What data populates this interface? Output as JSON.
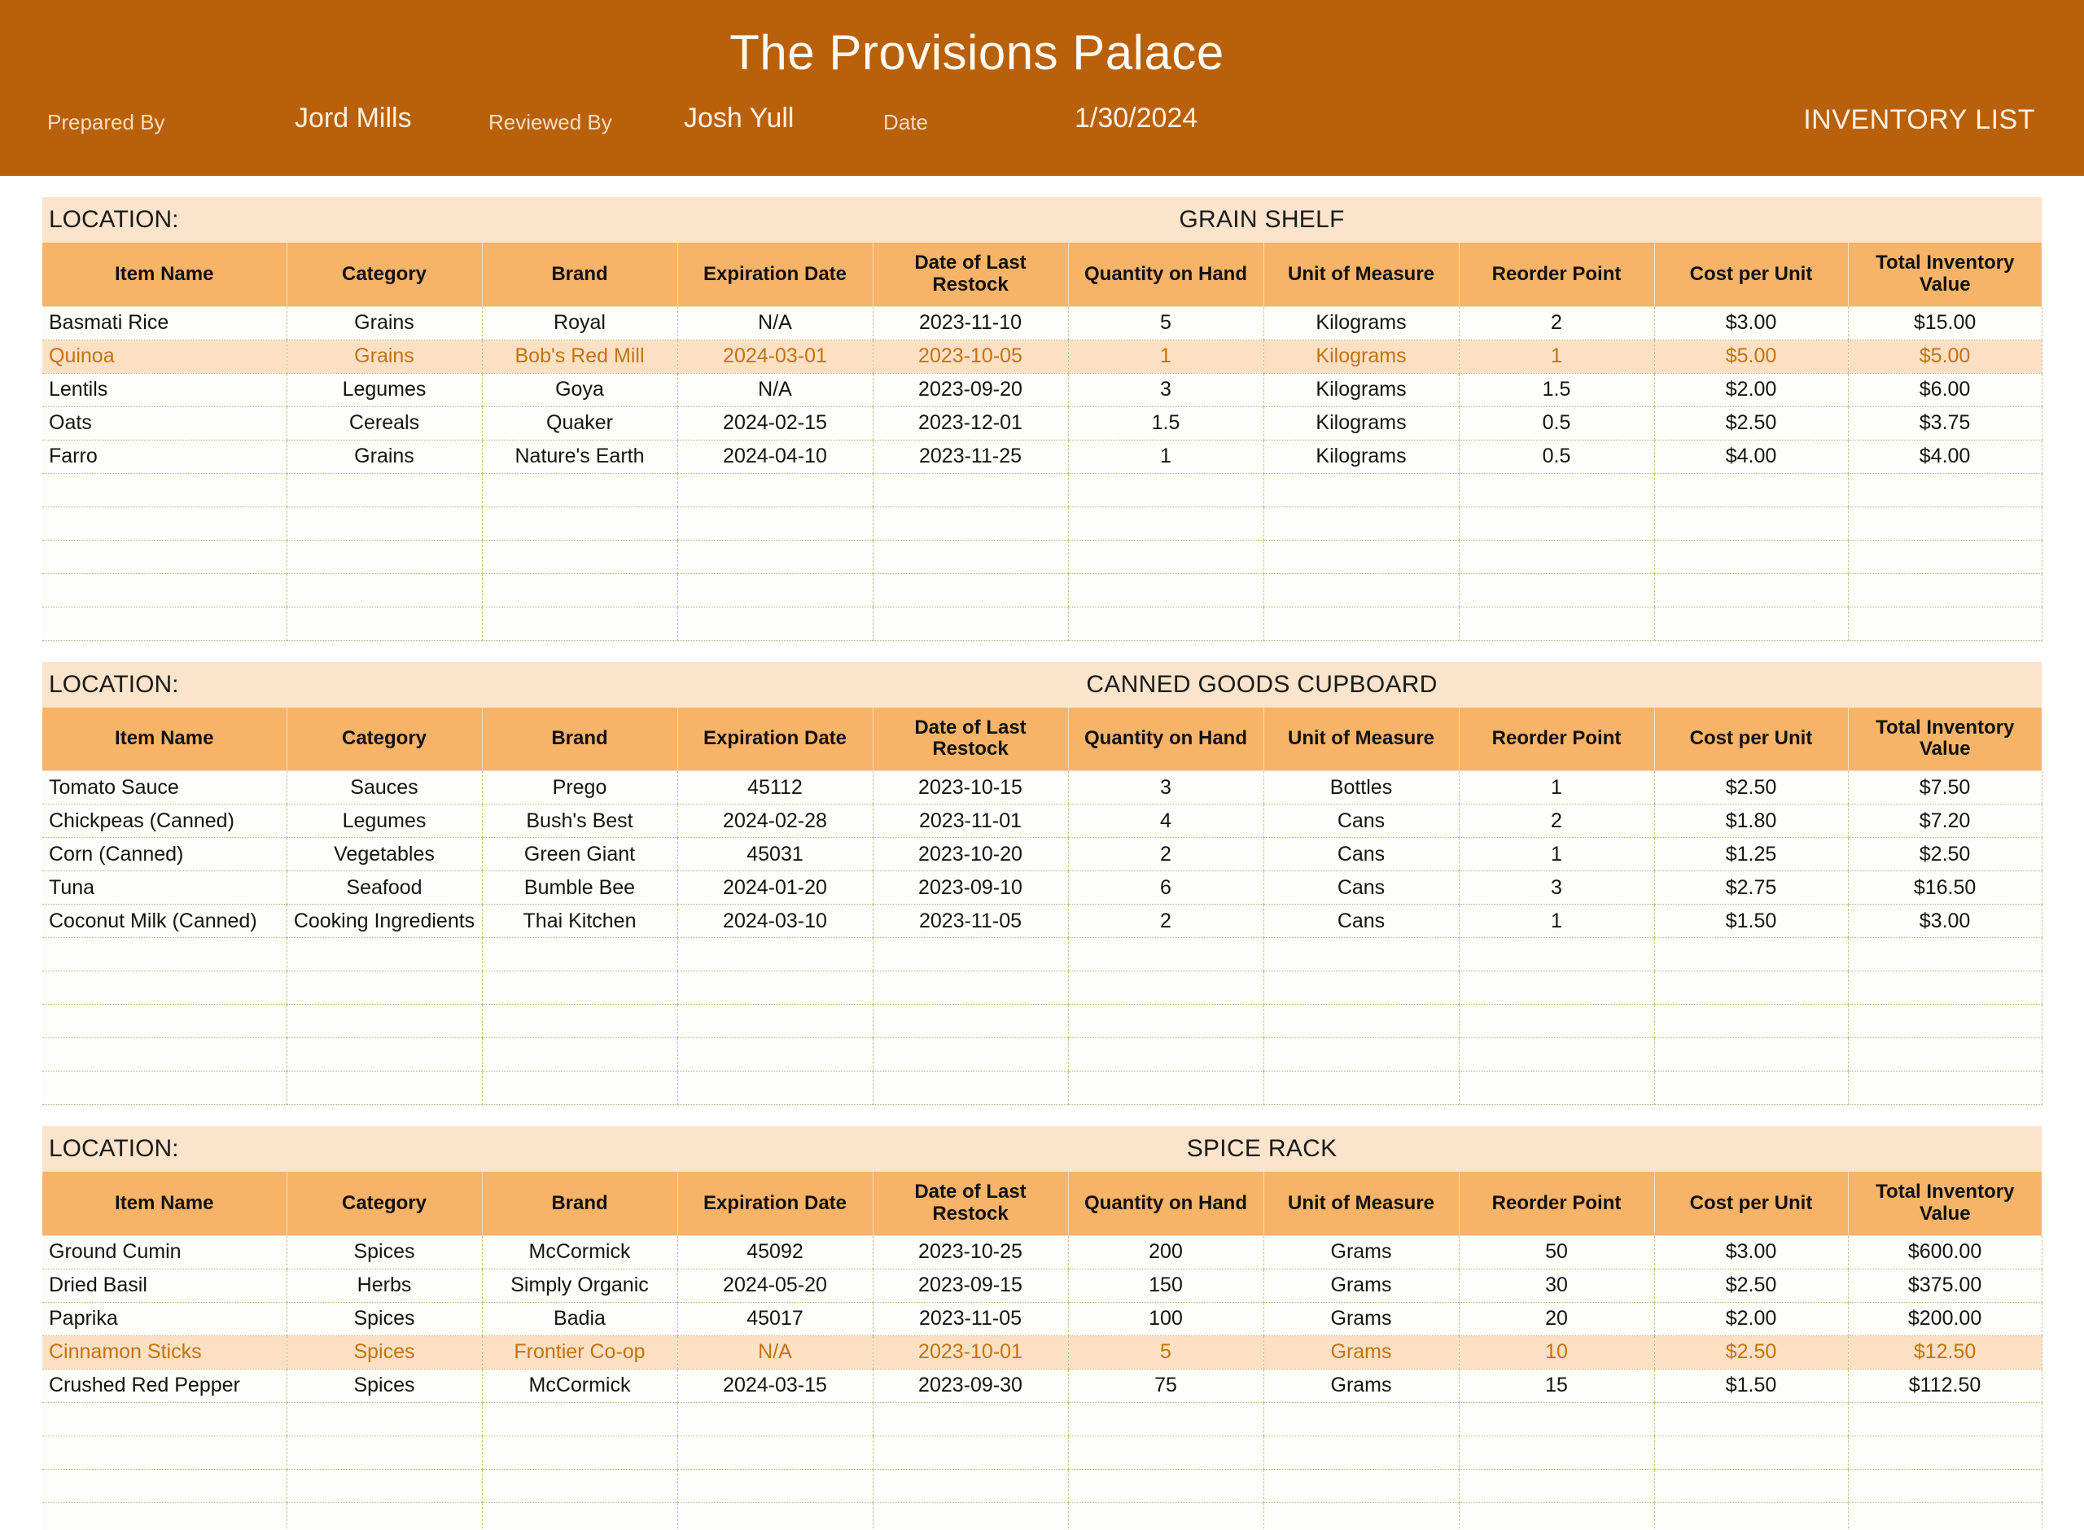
{
  "header": {
    "title": "The Provisions Palace",
    "prepared_by_label": "Prepared By",
    "prepared_by_value": "Jord Mills",
    "reviewed_by_label": "Reviewed By",
    "reviewed_by_value": "Josh Yull",
    "date_label": "Date",
    "date_value": "1/30/2024",
    "document_type": "INVENTORY LIST",
    "banner_color": "#b9600a",
    "accent_color": "#f7b368",
    "highlight_color": "#fbe0c4",
    "highlight_text_color": "#c4720c"
  },
  "location_label": "LOCATION:",
  "columns": [
    "Item Name",
    "Category",
    "Brand",
    "Expiration Date",
    "Date of Last Restock",
    "Quantity on Hand",
    "Unit of Measure",
    "Reorder Point",
    "Cost per Unit",
    "Total Inventory Value"
  ],
  "sections": [
    {
      "location": "GRAIN SHELF",
      "rows": [
        {
          "highlight": false,
          "cells": [
            "Basmati Rice",
            "Grains",
            "Royal",
            "N/A",
            "2023-11-10",
            "5",
            "Kilograms",
            "2",
            "$3.00",
            "$15.00"
          ]
        },
        {
          "highlight": true,
          "cells": [
            "Quinoa",
            "Grains",
            "Bob's Red Mill",
            "2024-03-01",
            "2023-10-05",
            "1",
            "Kilograms",
            "1",
            "$5.00",
            "$5.00"
          ]
        },
        {
          "highlight": false,
          "cells": [
            "Lentils",
            "Legumes",
            "Goya",
            "N/A",
            "2023-09-20",
            "3",
            "Kilograms",
            "1.5",
            "$2.00",
            "$6.00"
          ]
        },
        {
          "highlight": false,
          "cells": [
            "Oats",
            "Cereals",
            "Quaker",
            "2024-02-15",
            "2023-12-01",
            "1.5",
            "Kilograms",
            "0.5",
            "$2.50",
            "$3.75"
          ]
        },
        {
          "highlight": false,
          "cells": [
            "Farro",
            "Grains",
            "Nature's Earth",
            "2024-04-10",
            "2023-11-25",
            "1",
            "Kilograms",
            "0.5",
            "$4.00",
            "$4.00"
          ]
        }
      ],
      "empty_rows": 5
    },
    {
      "location": "CANNED GOODS CUPBOARD",
      "rows": [
        {
          "highlight": false,
          "cells": [
            "Tomato Sauce",
            "Sauces",
            "Prego",
            "45112",
            "2023-10-15",
            "3",
            "Bottles",
            "1",
            "$2.50",
            "$7.50"
          ]
        },
        {
          "highlight": false,
          "cells": [
            "Chickpeas (Canned)",
            "Legumes",
            "Bush's Best",
            "2024-02-28",
            "2023-11-01",
            "4",
            "Cans",
            "2",
            "$1.80",
            "$7.20"
          ]
        },
        {
          "highlight": false,
          "cells": [
            "Corn (Canned)",
            "Vegetables",
            "Green Giant",
            "45031",
            "2023-10-20",
            "2",
            "Cans",
            "1",
            "$1.25",
            "$2.50"
          ]
        },
        {
          "highlight": false,
          "cells": [
            "Tuna",
            "Seafood",
            "Bumble Bee",
            "2024-01-20",
            "2023-09-10",
            "6",
            "Cans",
            "3",
            "$2.75",
            "$16.50"
          ]
        },
        {
          "highlight": false,
          "cells": [
            "Coconut Milk (Canned)",
            "Cooking Ingredients",
            "Thai Kitchen",
            "2024-03-10",
            "2023-11-05",
            "2",
            "Cans",
            "1",
            "$1.50",
            "$3.00"
          ]
        }
      ],
      "empty_rows": 5
    },
    {
      "location": "SPICE RACK",
      "rows": [
        {
          "highlight": false,
          "cells": [
            "Ground Cumin",
            "Spices",
            "McCormick",
            "45092",
            "2023-10-25",
            "200",
            "Grams",
            "50",
            "$3.00",
            "$600.00"
          ]
        },
        {
          "highlight": false,
          "cells": [
            "Dried Basil",
            "Herbs",
            "Simply Organic",
            "2024-05-20",
            "2023-09-15",
            "150",
            "Grams",
            "30",
            "$2.50",
            "$375.00"
          ]
        },
        {
          "highlight": false,
          "cells": [
            "Paprika",
            "Spices",
            "Badia",
            "45017",
            "2023-11-05",
            "100",
            "Grams",
            "20",
            "$2.00",
            "$200.00"
          ]
        },
        {
          "highlight": true,
          "cells": [
            "Cinnamon Sticks",
            "Spices",
            "Frontier Co-op",
            "N/A",
            "2023-10-01",
            "5",
            "Grams",
            "10",
            "$2.50",
            "$12.50"
          ]
        },
        {
          "highlight": false,
          "cells": [
            "Crushed Red Pepper",
            "Spices",
            "McCormick",
            "2024-03-15",
            "2023-09-30",
            "75",
            "Grams",
            "15",
            "$1.50",
            "$112.50"
          ]
        }
      ],
      "empty_rows": 4
    }
  ]
}
